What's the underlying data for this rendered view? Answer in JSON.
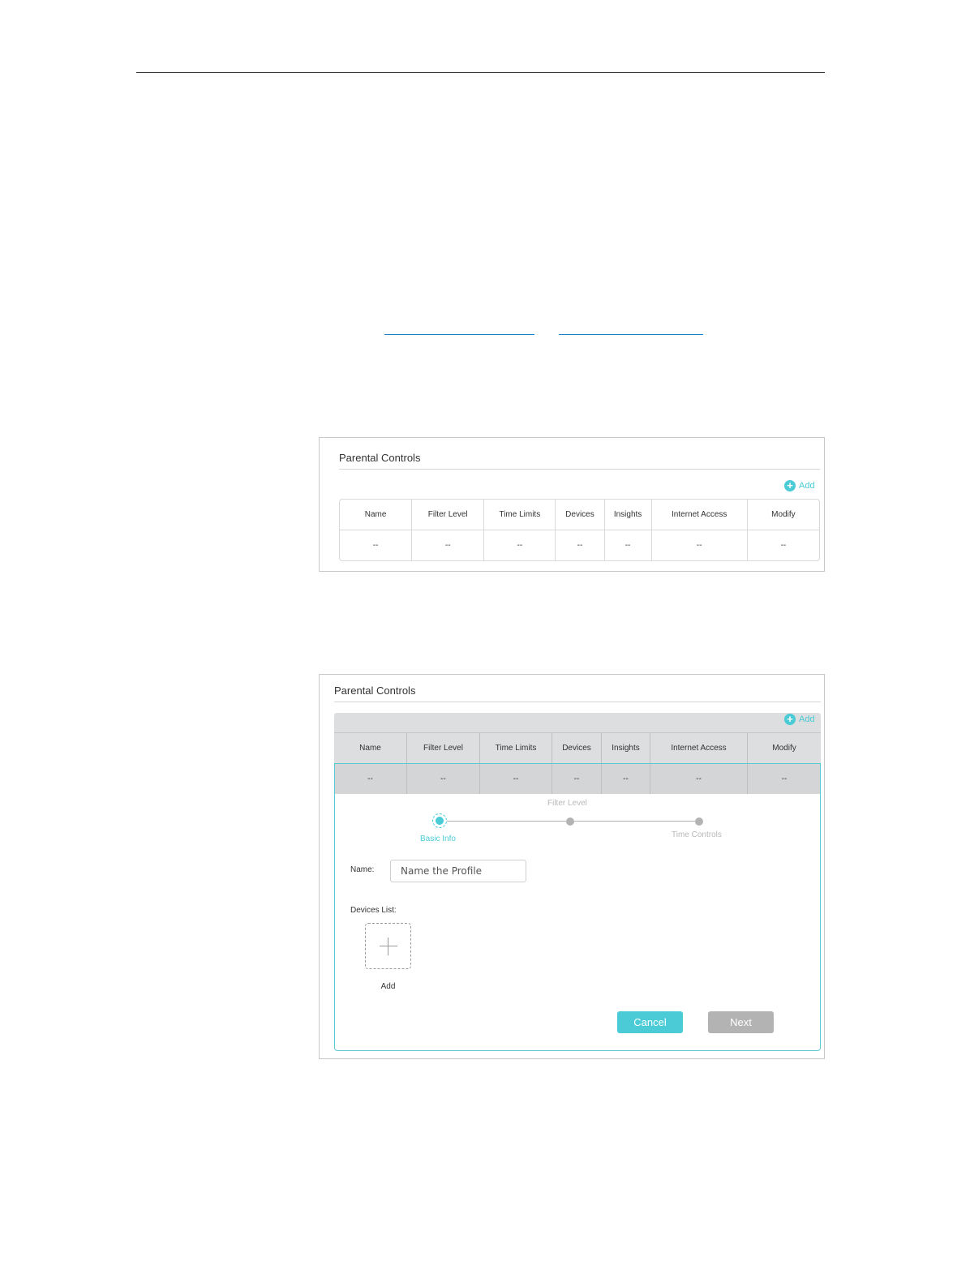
{
  "panel1": {
    "title": "Parental Controls",
    "add_label": "Add",
    "columns": [
      "Name",
      "Filter Level",
      "Time Limits",
      "Devices",
      "Insights",
      "Internet Access",
      "Modify"
    ],
    "row": [
      "--",
      "--",
      "--",
      "--",
      "--",
      "--",
      "--"
    ]
  },
  "panel2": {
    "title": "Parental Controls",
    "add_label": "Add",
    "columns": [
      "Name",
      "Filter Level",
      "Time Limits",
      "Devices",
      "Insights",
      "Internet Access",
      "Modify"
    ],
    "row": [
      "--",
      "--",
      "--",
      "--",
      "--",
      "--",
      "--"
    ],
    "steps": {
      "step1": "Basic Info",
      "step2": "Filter Level",
      "step3": "Time Controls"
    },
    "name_label": "Name:",
    "name_placeholder": "Name the Profile",
    "devices_label": "Devices List:",
    "device_add_label": "Add",
    "cancel_label": "Cancel",
    "next_label": "Next"
  },
  "colors": {
    "accent": "#4acbd6",
    "disabled": "#b3b3b3",
    "link": "#1f7fc6"
  }
}
